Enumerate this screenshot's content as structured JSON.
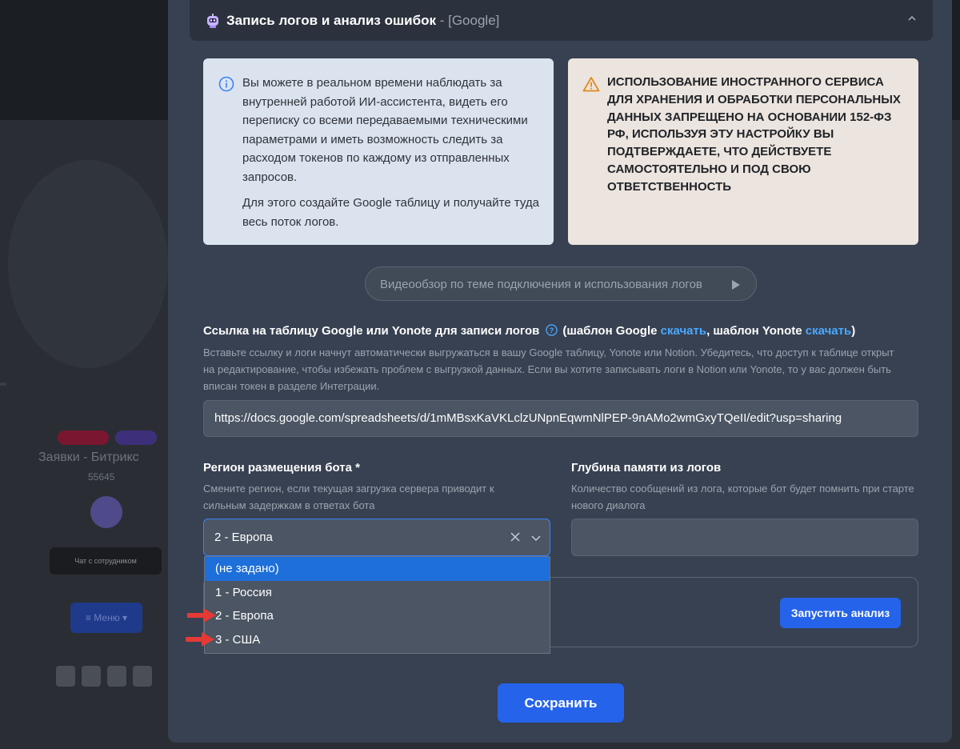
{
  "accordion": {
    "title": "Запись логов и анализ ошибок",
    "tag": " - [Google]"
  },
  "info": {
    "paragraph1": "Вы можете в реальном времени наблюдать за внутренней работой ИИ-ассистента, видеть его переписку со всеми передаваемыми техническими параметрами и иметь возможность следить за расходом токенов по каждому из отправленных запросов.",
    "paragraph2": "Для этого создайте Google таблицу и получайте туда весь поток логов."
  },
  "warning": {
    "text": "ИСПОЛЬЗОВАНИЕ ИНОСТРАННОГО СЕРВИСА ДЛЯ ХРАНЕНИЯ И ОБРАБОТКИ ПЕРСОНАЛЬНЫХ ДАННЫХ ЗАПРЕЩЕНО НА ОСНОВАНИИ 152-ФЗ РФ, ИСПОЛЬЗУЯ ЭТУ НАСТРОЙКУ ВЫ ПОДТВЕРЖДАЕТЕ, ЧТО ДЕЙСТВУЕТЕ САМОСТОЯТЕЛЬНО И ПОД СВОЮ ОТВЕТСТВЕННОСТЬ"
  },
  "video_button": "Видеообзор по теме подключения и использования логов",
  "log_link": {
    "label": "Ссылка на таблицу Google или Yonote для записи логов",
    "template_prefix": "(шаблон Google ",
    "template_google_link": "скачать",
    "template_middle": ", шаблон Yonote ",
    "template_yonote_link": "скачать",
    "template_suffix": ")",
    "description": "Вставьте ссылку и логи начнут автоматически выгружаться в вашу Google таблицу, Yonote или Notion. Убедитесь, что доступ к таблице открыт на редактирование, чтобы избежать проблем с выгрузкой данных. Если вы хотите записывать логи в Notion или Yonote, то у вас должен быть вписан токен в разделе Интеграции.",
    "value": "https://docs.google.com/spreadsheets/d/1mMBsxKaVKLclzUNpnEqwmNlPEP-9nAMo2wmGxyTQeII/edit?usp=sharing"
  },
  "region": {
    "label": "Регион размещения бота *",
    "description": "Смените регион, если текущая загрузка сервера приводит к сильным задержкам в ответах бота",
    "selected": "2 - Европа",
    "options": [
      "(не задано)",
      "1 - Россия",
      "2 - Европа",
      "3 - США"
    ]
  },
  "depth": {
    "label": "Глубина памяти из логов",
    "description": "Количество сообщений из лога, которые бот будет помнить при старте нового диалога",
    "value": ""
  },
  "run_analysis_button": "Запустить анализ",
  "save_button": "Сохранить",
  "background": {
    "title": "Заявки - Битрикс",
    "subtitle": "55645",
    "chat": "Чат с сотрудником",
    "menu": "≡ Меню ▾"
  },
  "colors": {
    "modal_bg": "#374151",
    "primary": "#2563eb",
    "link": "#4aa8ff",
    "warning_bg": "#ece4de",
    "info_bg": "#dbe3ee",
    "arrow_red": "#e53935"
  }
}
